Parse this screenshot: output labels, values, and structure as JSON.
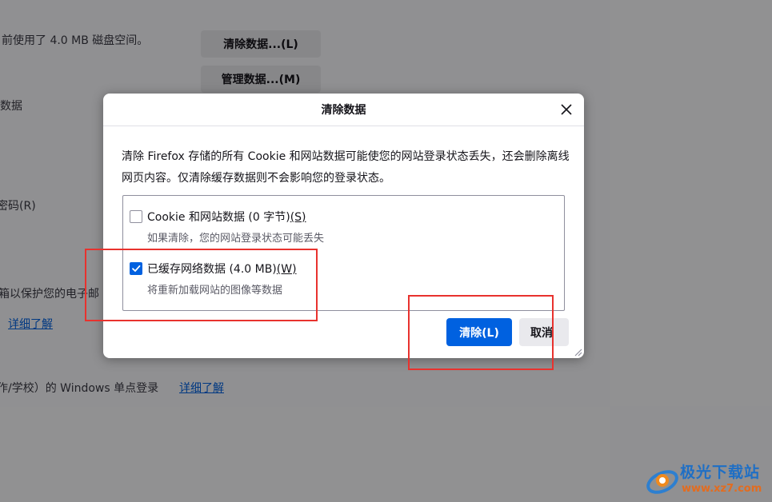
{
  "background": {
    "disk_usage_text": "前使用了 4.0 MB 磁盘空间。",
    "clear_data_button": "清除数据...(L)",
    "manage_data_button": "管理数据...(M)",
    "label_data": "数据",
    "label_password": "密码(R)",
    "protect_text": "箱以保护您的电子邮",
    "learn_more_1": "详细了解",
    "sso_text": "作/学校）的 Windows 单点登录",
    "learn_more_2": "详细了解"
  },
  "dialog": {
    "title": "清除数据",
    "close_icon": "close-icon",
    "description": "清除 Firefox 存储的所有 Cookie 和网站数据可能使您的网站登录状态丢失，还会删除离线网页内容。仅清除缓存数据则不会影响您的登录状态。",
    "options": [
      {
        "label": "Cookie 和网站数据 (0 字节)",
        "accesskey": "(S)",
        "description": "如果清除，您的网站登录状态可能丢失",
        "checked": false
      },
      {
        "label": "已缓存网络数据 (4.0 MB)",
        "accesskey": "(W)",
        "description": "将重新加载网站的图像等数据",
        "checked": true
      }
    ],
    "clear_button": "清除(L)",
    "cancel_button": "取消"
  },
  "watermark": {
    "title": "极光下载站",
    "url": "www.xz7.com"
  },
  "colors": {
    "accent": "#0061e0",
    "annotation": "#e8322e"
  }
}
